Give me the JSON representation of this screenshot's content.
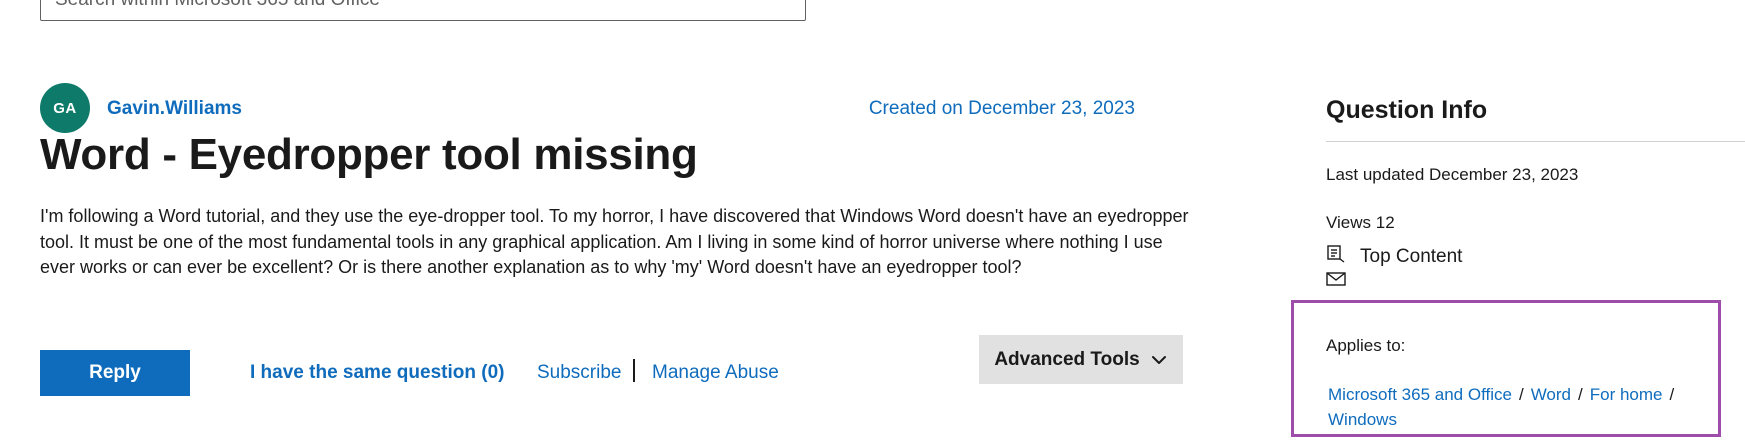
{
  "search": {
    "placeholder": "Search within Microsoft 365 and Office"
  },
  "post": {
    "author_initials": "GA",
    "author_name": "Gavin.Williams",
    "created_on": "Created on December 23, 2023",
    "title": "Word - Eyedropper tool missing",
    "body": "I'm following a Word tutorial, and they use the eye-dropper tool. To my horror, I have discovered that Windows Word doesn't have an eyedropper tool. It must be one of the most fundamental tools in any graphical application. Am I living in some kind of horror universe where nothing I use ever works or can ever be excellent? Or is there another explanation as to why 'my' Word doesn't have an eyedropper tool?"
  },
  "actions": {
    "reply_label": "Reply",
    "same_question_label": "I have the same question (0)",
    "subscribe_label": "Subscribe",
    "manage_abuse_label": "Manage Abuse",
    "advanced_tools_label": "Advanced Tools"
  },
  "sidebar": {
    "title": "Question Info",
    "last_updated": "Last updated December 23, 2023",
    "views": "Views 12",
    "top_content_label": "Top Content",
    "applies_to_label": "Applies to:",
    "applies_to": [
      {
        "label": "Microsoft 365 and Office"
      },
      {
        "label": "Word"
      },
      {
        "label": "For home"
      },
      {
        "label": "Windows"
      }
    ],
    "separator": "/"
  },
  "colors": {
    "link": "#0f6cbd",
    "avatar_bg": "#0e7a69",
    "highlight_border": "#9e4dab",
    "advanced_tools_bg": "#e1e1e1"
  }
}
